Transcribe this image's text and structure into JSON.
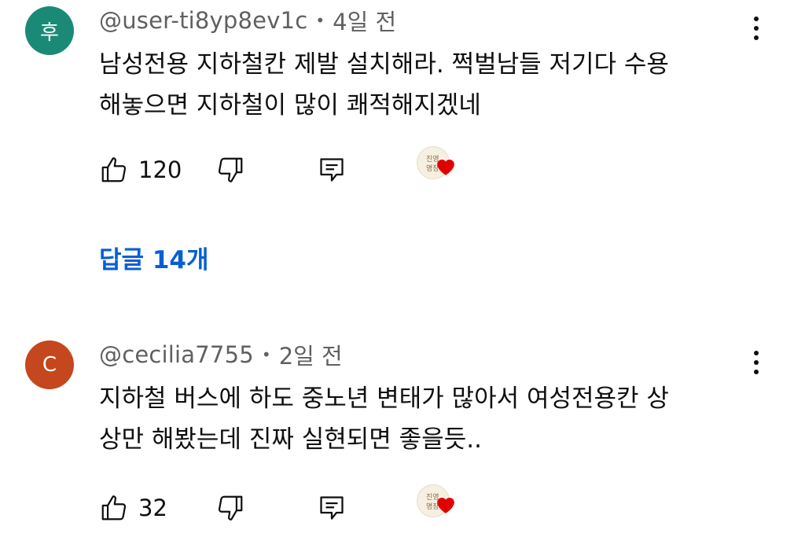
{
  "comments": [
    {
      "avatar_text": "후",
      "avatar_color": "#1a8a77",
      "handle": "@user-ti8yp8ev1c",
      "separator": "•",
      "time": "4일 전",
      "body_lines": [
        "남성전용 지하철칸 제발 설치해라. 쩍벌남들 저기다 수용",
        "해놓으면 지하철이 많이 쾌적해지겠네"
      ],
      "likes": "120",
      "replies_label": "답글 14개"
    },
    {
      "avatar_text": "C",
      "avatar_color": "#c4471d",
      "handle": "@cecilia7755",
      "separator": "•",
      "time": "2일 전",
      "body_lines": [
        "지하철 버스에 하도 중노년 변태가 많아서 여성전용칸 상",
        "상만 해봤는데 진짜 실현되면 좋을듯.."
      ],
      "likes": "32"
    }
  ],
  "colors": {
    "meta_text": "#606060",
    "link_blue": "#065fd4",
    "heart_red": "#e00000"
  },
  "icons": [
    "thumb-up-icon",
    "thumb-down-icon",
    "reply-icon",
    "creator-heart-icon",
    "more-vert-icon"
  ]
}
